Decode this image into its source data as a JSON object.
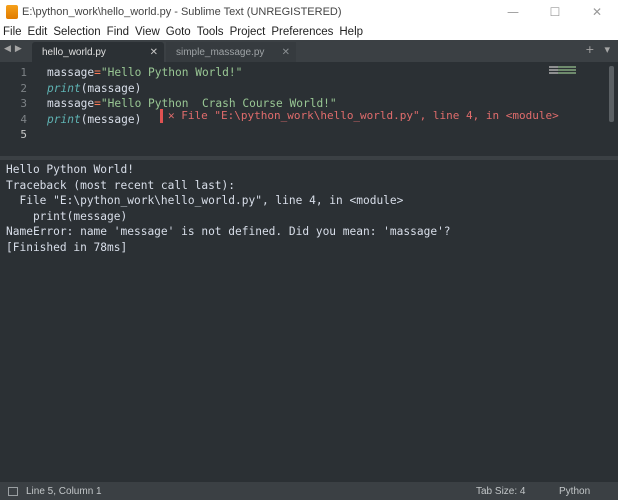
{
  "window": {
    "title": "E:\\python_work\\hello_world.py - Sublime Text (UNREGISTERED)",
    "controls": {
      "minimize": "—",
      "maximize": "☐",
      "close": "✕"
    }
  },
  "menu": {
    "items": [
      "File",
      "Edit",
      "Selection",
      "Find",
      "View",
      "Goto",
      "Tools",
      "Project",
      "Preferences",
      "Help"
    ]
  },
  "tabs": {
    "nav_left": "◀",
    "nav_right": "▶",
    "items": [
      {
        "label": "hello_world.py",
        "active": true,
        "close": "✕"
      },
      {
        "label": "simple_massage.py",
        "active": false,
        "close": "✕"
      }
    ],
    "add": "+",
    "dropdown": "▾"
  },
  "editor": {
    "line_numbers": [
      "1",
      "2",
      "3",
      "4",
      "5"
    ],
    "current_line": 5,
    "lines": [
      [
        {
          "t": "massage",
          "c": "var"
        },
        {
          "t": "=",
          "c": "op"
        },
        {
          "t": "\"Hello Python World!\"",
          "c": "str"
        }
      ],
      [
        {
          "t": "print",
          "c": "fn"
        },
        {
          "t": "(massage)",
          "c": "paren"
        }
      ],
      [
        {
          "t": "massage",
          "c": "var"
        },
        {
          "t": "=",
          "c": "op"
        },
        {
          "t": "\"Hello Python  Crash Course World!\"",
          "c": "str"
        }
      ],
      [
        {
          "t": "print",
          "c": "fn"
        },
        {
          "t": "(message)",
          "c": "paren"
        }
      ],
      []
    ],
    "error_phantom": {
      "close": "✕",
      "text": "File \"E:\\python_work\\hello_world.py\", line 4, in <module>"
    }
  },
  "output": {
    "lines": [
      "Hello Python World!",
      "Traceback (most recent call last):",
      "  File \"E:\\python_work\\hello_world.py\", line 4, in <module>",
      "    print(message)",
      "NameError: name 'message' is not defined. Did you mean: 'massage'?",
      "[Finished in 78ms]"
    ]
  },
  "status": {
    "position": "Line 5, Column 1",
    "tab_size": "Tab Size: 4",
    "syntax": "Python"
  },
  "colors": {
    "editor_bg": "#2b3034",
    "string": "#99c794",
    "operator": "#f97b58",
    "function": "#5fb4b4",
    "error": "#e05252"
  }
}
